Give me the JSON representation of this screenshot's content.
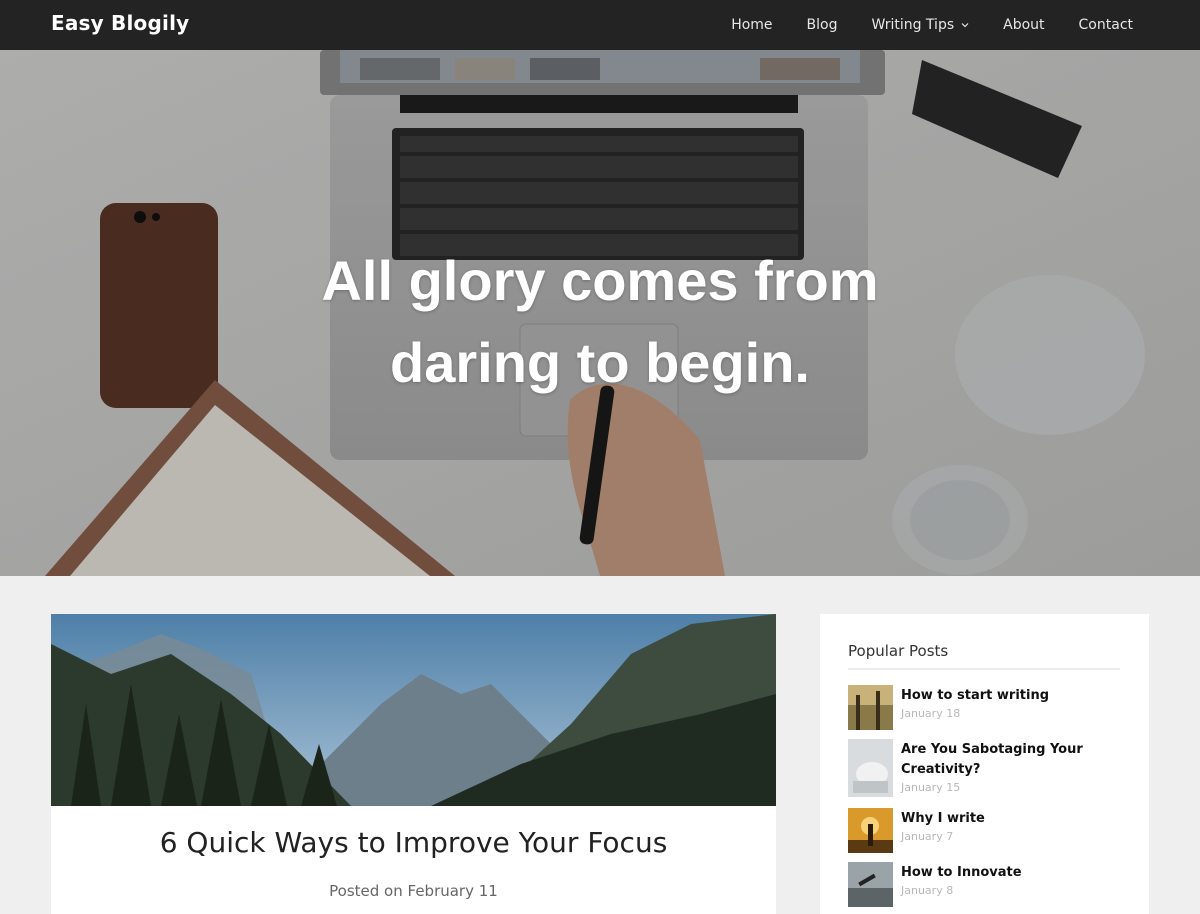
{
  "site": {
    "title": "Easy Blogily"
  },
  "nav": {
    "items": [
      {
        "label": "Home"
      },
      {
        "label": "Blog"
      },
      {
        "label": "Writing Tips",
        "icon": "chevron-down-icon"
      },
      {
        "label": "About"
      },
      {
        "label": "Contact"
      }
    ]
  },
  "hero": {
    "quote_line1": "All glory comes from",
    "quote_line2": "daring to begin."
  },
  "post": {
    "title": "6 Quick Ways to Improve Your Focus",
    "meta": "Posted on February 11"
  },
  "sidebar": {
    "widget_title": "Popular Posts",
    "posts": [
      {
        "title": "How to start writing",
        "date": "January 18"
      },
      {
        "title": "Are You Sabotaging Your Creativity?",
        "date": "January 15"
      },
      {
        "title": "Why I write",
        "date": "January 7"
      },
      {
        "title": "How to Innovate",
        "date": "January 8"
      }
    ]
  },
  "colors": {
    "navbar_bg": "#232323",
    "page_bg": "#efefef",
    "card_bg": "#ffffff"
  }
}
